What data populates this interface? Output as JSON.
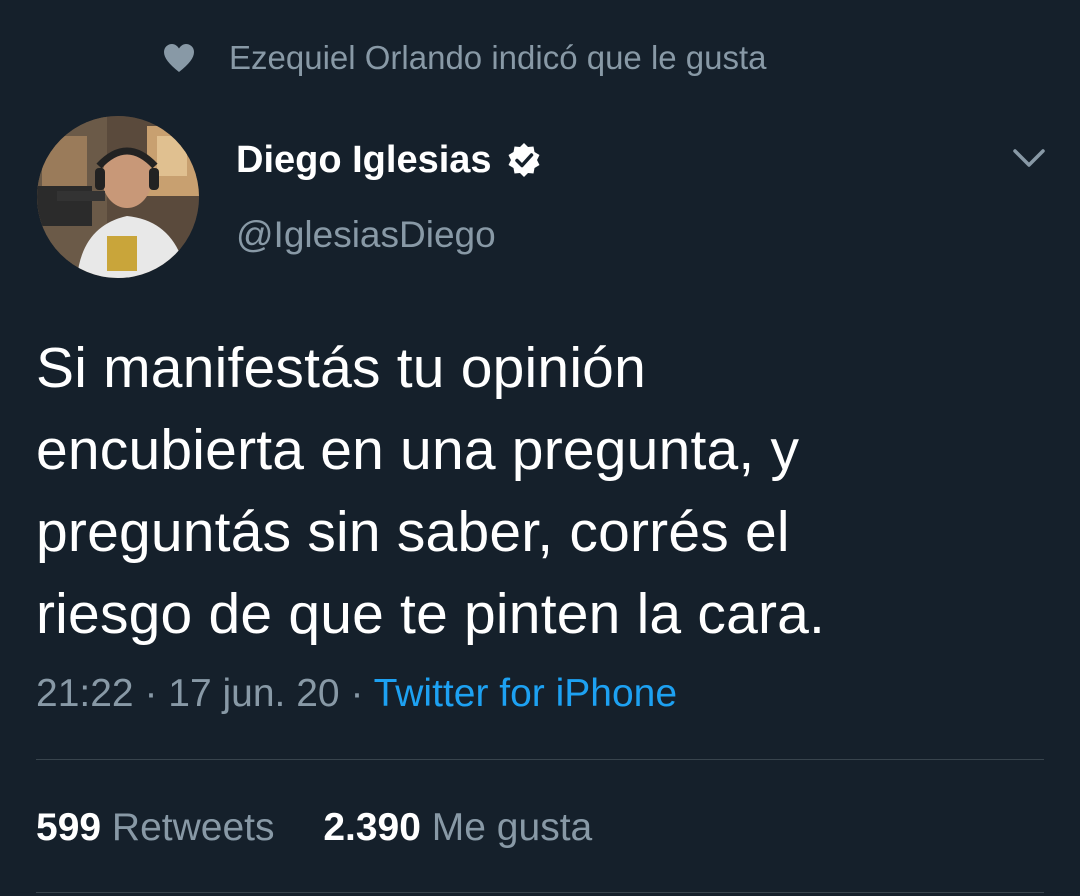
{
  "social_context": {
    "text": "Ezequiel Orlando indicó que le gusta",
    "icon": "heart-icon"
  },
  "author": {
    "display_name": "Diego Iglesias",
    "username": "@IglesiasDiego",
    "verified": true,
    "verified_icon": "verified-badge-icon"
  },
  "tweet": {
    "lines": [
      "Si manifestás tu opinión",
      "encubierta en una pregunta, y",
      "preguntás sin saber, corrés el",
      "riesgo de que te pinten la cara."
    ],
    "time": "21:22",
    "date": "17 jun. 20",
    "separator": "·",
    "source": "Twitter for iPhone"
  },
  "stats": {
    "retweets_count": "599",
    "retweets_label": "Retweets",
    "likes_count": "2.390",
    "likes_label": "Me gusta"
  },
  "colors": {
    "background": "#15202b",
    "secondary_text": "#8899a6",
    "link": "#1da1f2",
    "divider": "#38444d"
  }
}
